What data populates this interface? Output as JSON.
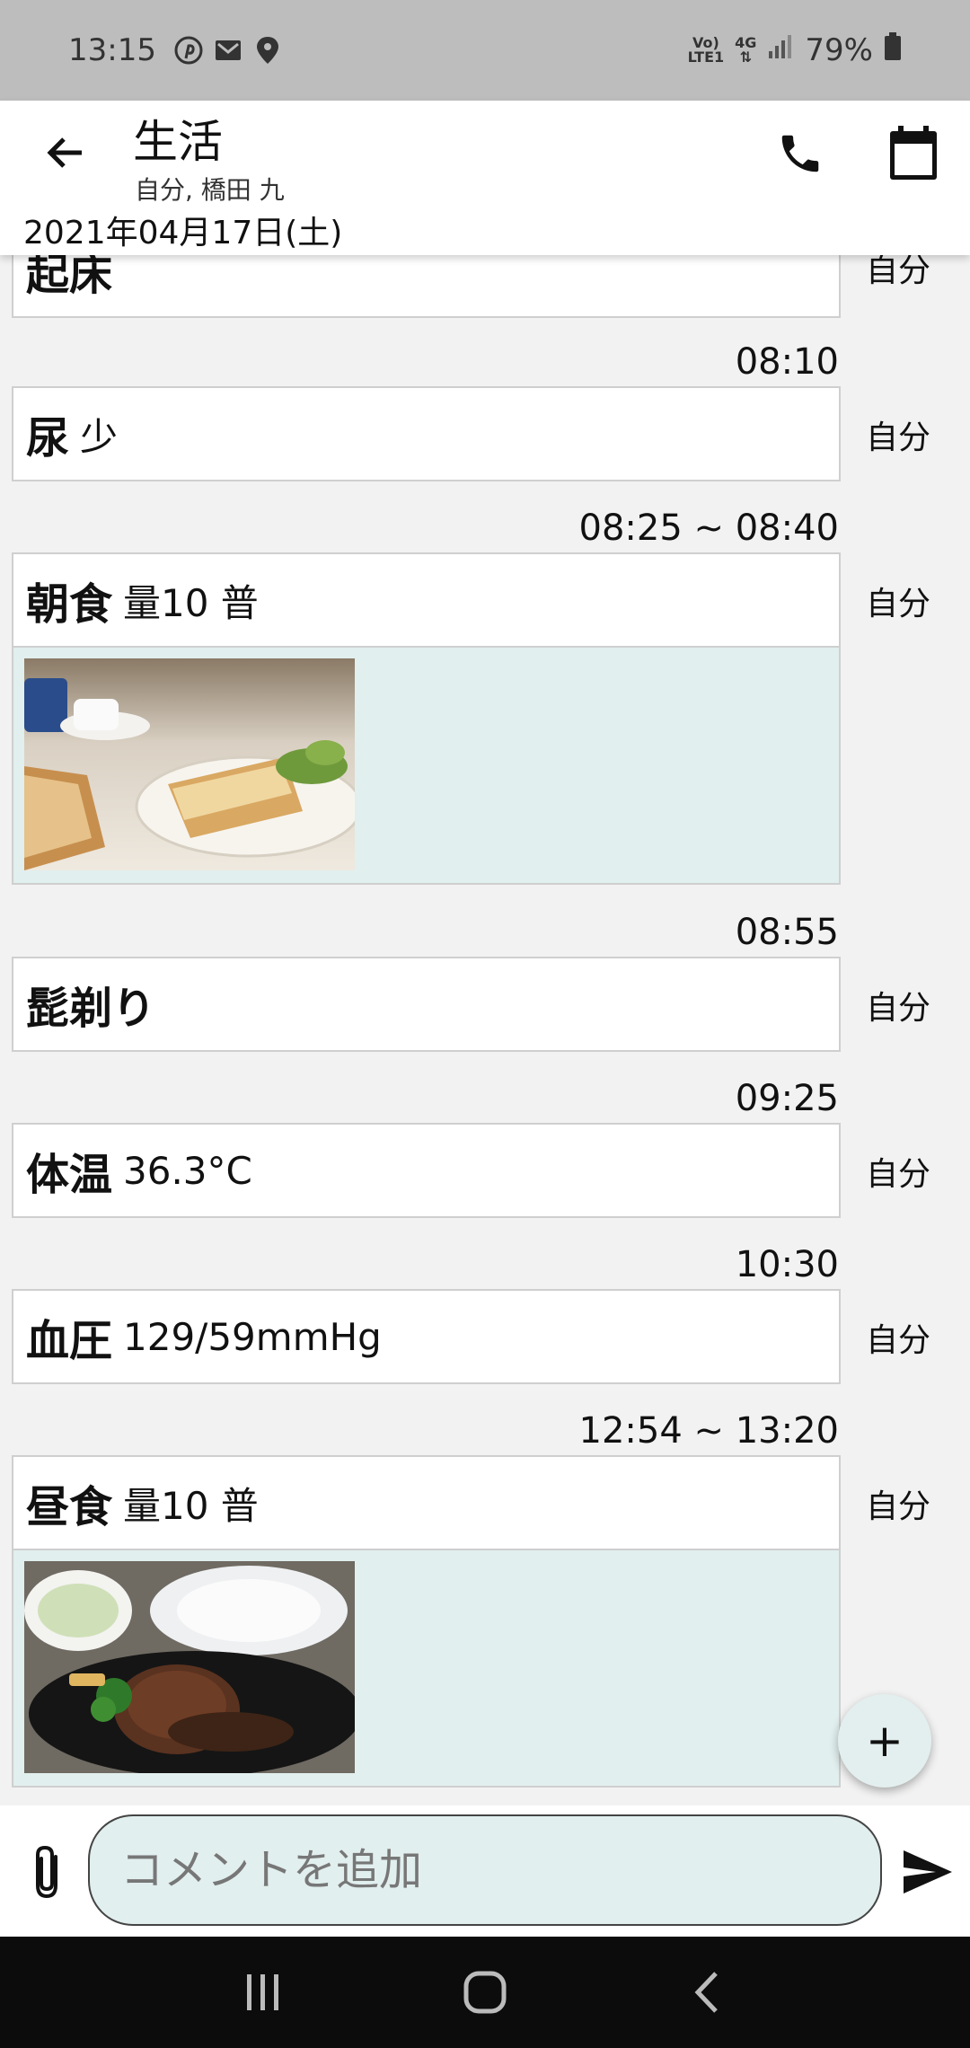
{
  "status_bar": {
    "time": "13:15",
    "network_label_top": "Vo)",
    "network_label_bottom": "LTE1",
    "network_type": "4G",
    "battery": "79%",
    "icons": [
      "pinterest-icon",
      "gmail-icon",
      "location-icon",
      "signal-icon",
      "battery-icon"
    ]
  },
  "app_bar": {
    "title": "生活",
    "subtitle": "自分, 橋田 九",
    "date": "2021年04月17日(土)",
    "icons": [
      "back-arrow-icon",
      "phone-icon",
      "calendar-icon"
    ]
  },
  "entries": [
    {
      "time": "",
      "title": "起床",
      "detail": "",
      "author": "自分",
      "photo": null
    },
    {
      "time": "08:10",
      "title": "尿",
      "detail": "少",
      "author": "自分",
      "photo": null
    },
    {
      "time": "08:25 ~ 08:40",
      "title": "朝食",
      "detail": "量10 普",
      "author": "自分",
      "photo": "breakfast-toast-photo"
    },
    {
      "time": "08:55",
      "title": "髭剃り",
      "detail": "",
      "author": "自分",
      "photo": null
    },
    {
      "time": "09:25",
      "title": "体温",
      "detail": "36.3°C",
      "author": "自分",
      "photo": null
    },
    {
      "time": "10:30",
      "title": "血圧",
      "detail": "129/59mmHg",
      "author": "自分",
      "photo": null
    },
    {
      "time": "12:54 ~ 13:20",
      "title": "昼食",
      "detail": "量10 普",
      "author": "自分",
      "photo": "lunch-hamburg-photo"
    }
  ],
  "fab": {
    "label": "+"
  },
  "composer": {
    "placeholder": "コメントを追加"
  },
  "colors": {
    "status_bar": "#bdbdbd",
    "app_bar": "#ffffff",
    "background": "#f2f2f2",
    "photo_area": "#e1efee",
    "nav_bar": "#0c0c0c"
  }
}
